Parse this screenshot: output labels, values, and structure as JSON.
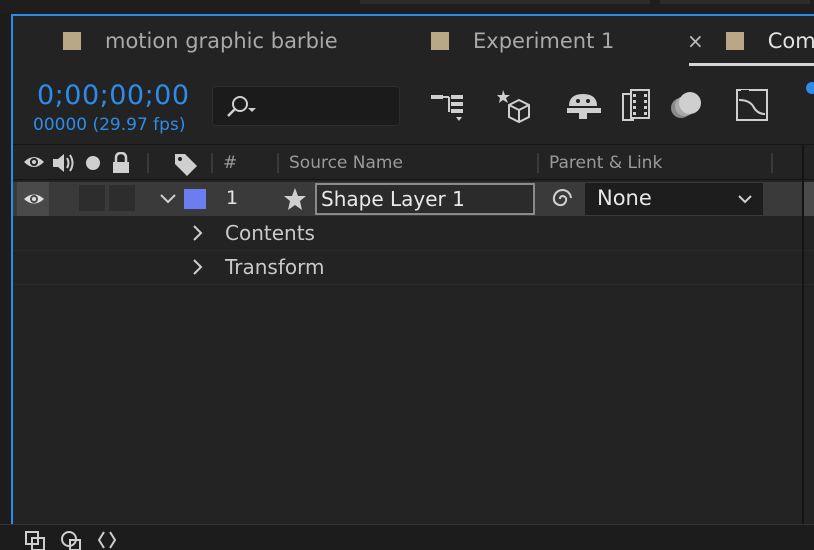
{
  "tabs": [
    {
      "label": "motion graphic barbie",
      "active": false
    },
    {
      "label": "Experiment 1",
      "active": false
    },
    {
      "label": "Comp",
      "active": true,
      "closable": true
    }
  ],
  "tab_close_glyph": "×",
  "toolbar": {
    "timecode": "0;00;00;00",
    "frame_count": "00000 (29.97 fps)",
    "search_placeholder": ""
  },
  "columns": {
    "number": "#",
    "source_name": "Source Name",
    "parent_link": "Parent & Link"
  },
  "layer": {
    "number": "1",
    "name": "Shape Layer 1",
    "label_color": "#6c7df0",
    "parent": "None"
  },
  "properties": [
    "Contents",
    "Transform"
  ],
  "colors": {
    "accent": "#2d8ceb",
    "panel_bg": "#232323",
    "selected_row": "#3a3a3a"
  },
  "icons": [
    "search-icon",
    "comp-flowchart-icon",
    "draft-3d-icon",
    "shy-layers-icon",
    "frame-blending-icon",
    "motion-blur-icon",
    "graph-editor-icon",
    "eye-icon",
    "audio-icon",
    "solo-icon",
    "lock-icon",
    "label-tag-icon",
    "star-icon",
    "pickwhip-icon",
    "chevron-down-icon",
    "chevron-right-icon"
  ]
}
